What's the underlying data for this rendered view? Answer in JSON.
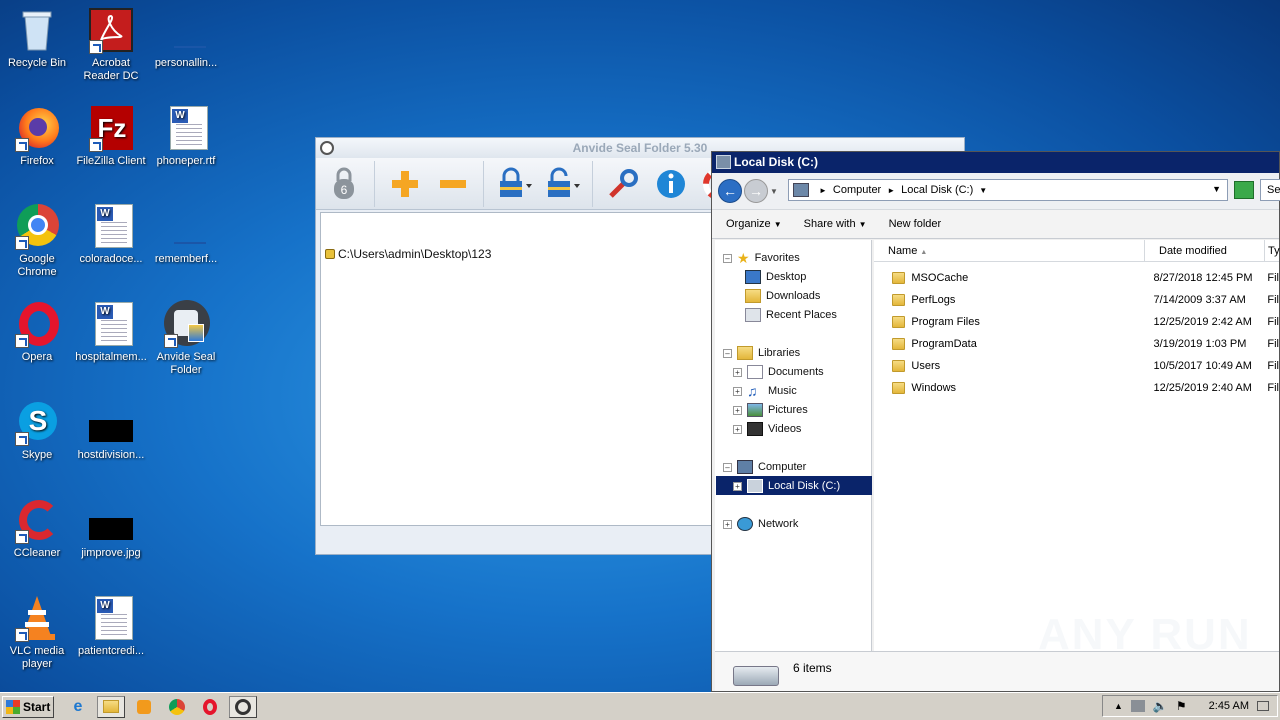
{
  "desktop": {
    "icons": [
      {
        "label": "Recycle Bin"
      },
      {
        "label": "Acrobat Reader DC"
      },
      {
        "label": "personallin..."
      },
      {
        "label": "Firefox"
      },
      {
        "label": "FileZilla Client"
      },
      {
        "label": "phoneper.rtf"
      },
      {
        "label": "Google Chrome"
      },
      {
        "label": "coloradoce..."
      },
      {
        "label": "rememberf..."
      },
      {
        "label": "Opera"
      },
      {
        "label": "hospitalmem..."
      },
      {
        "label": "Anvide Seal Folder"
      },
      {
        "label": "Skype"
      },
      {
        "label": "hostdivision..."
      },
      {
        "label": "CCleaner"
      },
      {
        "label": "jimprove.jpg"
      },
      {
        "label": "VLC media player"
      },
      {
        "label": "patientcredi..."
      }
    ]
  },
  "anvide": {
    "title": "Anvide Seal Folder 5.30",
    "folder_path": "C:\\Users\\admin\\Desktop\\123"
  },
  "explorer": {
    "title": "Local Disk (C:)",
    "breadcrumb": [
      "Computer",
      "Local Disk (C:)"
    ],
    "search_placeholder": "Se",
    "commands": {
      "organize": "Organize",
      "share_with": "Share with",
      "new_folder": "New folder"
    },
    "nav": {
      "favorites": "Favorites",
      "desktop": "Desktop",
      "downloads": "Downloads",
      "recent": "Recent Places",
      "libraries": "Libraries",
      "documents": "Documents",
      "music": "Music",
      "pictures": "Pictures",
      "videos": "Videos",
      "computer": "Computer",
      "local_disk": "Local Disk (C:)",
      "network": "Network"
    },
    "columns": {
      "name": "Name",
      "date": "Date modified",
      "type": "Ty"
    },
    "files": [
      {
        "name": "MSOCache",
        "date": "8/27/2018 12:45 PM",
        "type": "Fil"
      },
      {
        "name": "PerfLogs",
        "date": "7/14/2009 3:37 AM",
        "type": "Fil"
      },
      {
        "name": "Program Files",
        "date": "12/25/2019 2:42 AM",
        "type": "Fil"
      },
      {
        "name": "ProgramData",
        "date": "3/19/2019 1:03 PM",
        "type": "Fil"
      },
      {
        "name": "Users",
        "date": "10/5/2017 10:49 AM",
        "type": "Fil"
      },
      {
        "name": "Windows",
        "date": "12/25/2019 2:40 AM",
        "type": "Fil"
      }
    ],
    "status": "6 items"
  },
  "taskbar": {
    "start": "Start",
    "clock": "2:45 AM"
  },
  "watermark": "ANY RUN"
}
